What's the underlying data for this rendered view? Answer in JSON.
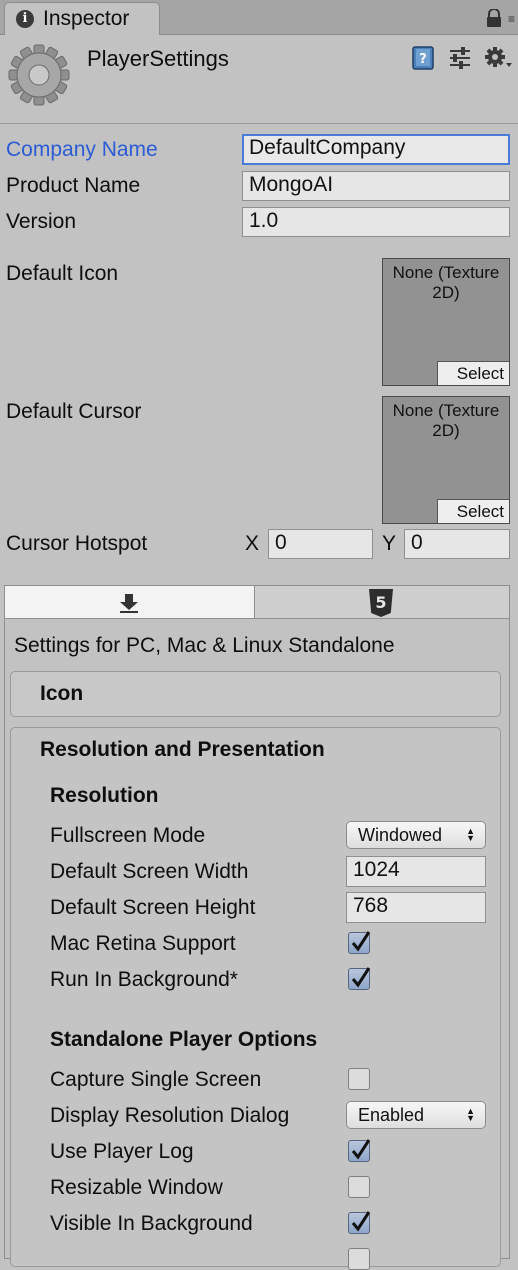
{
  "window": {
    "tab_title": "Inspector",
    "title": "PlayerSettings"
  },
  "fields": {
    "company_name_label": "Company Name",
    "company_name_value": "DefaultCompany",
    "product_name_label": "Product Name",
    "product_name_value": "MongoAI",
    "version_label": "Version",
    "version_value": "1.0",
    "default_icon_label": "Default Icon",
    "default_cursor_label": "Default Cursor",
    "texture_line1": "None (Texture",
    "texture_line2": "2D)",
    "select_label": "Select",
    "cursor_hotspot_label": "Cursor Hotspot",
    "hotspot_x_label": "X",
    "hotspot_x_value": "0",
    "hotspot_y_label": "Y",
    "hotspot_y_value": "0"
  },
  "platform": {
    "tabs": [
      "standalone-download-icon",
      "html5-icon"
    ],
    "selected_tab": 0,
    "settings_title": "Settings for PC, Mac & Linux Standalone"
  },
  "sections": {
    "icon_header": "Icon",
    "resolution_header": "Resolution and Presentation",
    "resolution_subheader": "Resolution",
    "fullscreen_mode_label": "Fullscreen Mode",
    "fullscreen_mode_value": "Windowed",
    "screen_width_label": "Default Screen Width",
    "screen_width_value": "1024",
    "screen_height_label": "Default Screen Height",
    "screen_height_value": "768",
    "mac_retina_label": "Mac Retina Support",
    "mac_retina_checked": true,
    "run_in_background_label": "Run In Background*",
    "run_in_background_checked": true,
    "standalone_subheader": "Standalone Player Options",
    "capture_single_screen_label": "Capture Single Screen",
    "capture_single_screen_checked": false,
    "display_resolution_label": "Display Resolution Dialog",
    "display_resolution_value": "Enabled",
    "use_player_log_label": "Use Player Log",
    "use_player_log_checked": true,
    "resizable_window_label": "Resizable Window",
    "resizable_window_checked": false,
    "visible_in_background_label": "Visible In Background",
    "visible_in_background_checked": true
  },
  "colors": {
    "focus_label": "#2b5cd6",
    "panel_background": "#c2c2c2"
  }
}
